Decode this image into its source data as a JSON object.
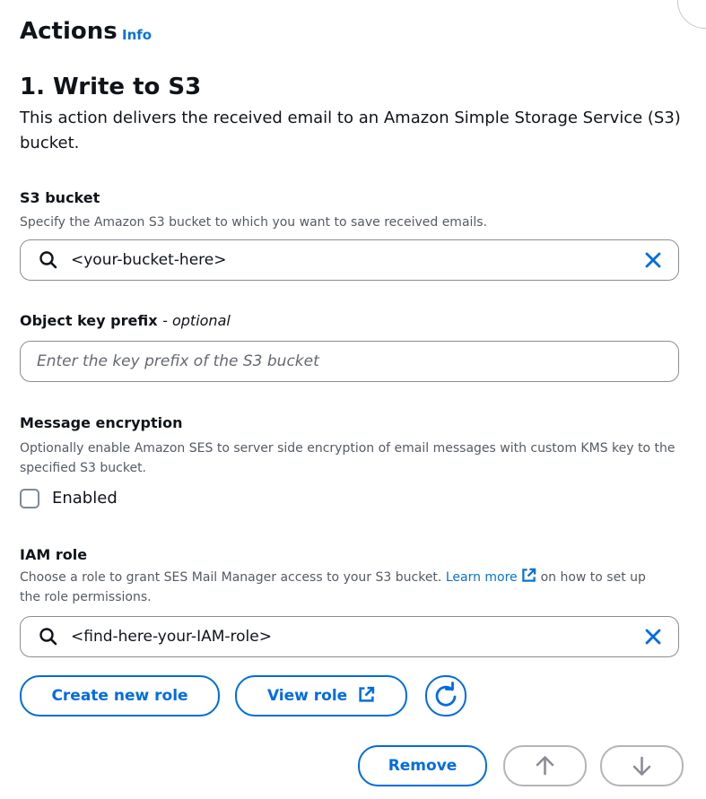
{
  "header": {
    "title": "Actions",
    "info_link": "Info"
  },
  "step": {
    "title": "1. Write to S3",
    "description": "This action delivers the received email to an Amazon Simple Storage Service (S3) bucket."
  },
  "s3_bucket": {
    "label": "S3 bucket",
    "description": "Specify the Amazon S3 bucket to which you want to save received emails.",
    "value": "<your-bucket-here>"
  },
  "object_key_prefix": {
    "label": "Object key prefix",
    "optional": "- optional",
    "placeholder": "Enter the key prefix of the S3 bucket"
  },
  "message_encryption": {
    "label": "Message encryption",
    "description": "Optionally enable Amazon SES to server side encryption of email messages with custom KMS key to the specified S3 bucket.",
    "checkbox_label": "Enabled",
    "checked": false
  },
  "iam_role": {
    "label": "IAM role",
    "description_before": "Choose a role to grant SES Mail Manager access to your S3 bucket.",
    "learn_more": "Learn more",
    "description_after": "on how to set up the role permissions.",
    "value": "<find-here-your-IAM-role>",
    "create_button": "Create new role",
    "view_button": "View role"
  },
  "footer": {
    "remove_button": "Remove"
  },
  "colors": {
    "accent": "#006ce0",
    "link": "#0972d3",
    "muted_border": "#b4b4bb"
  },
  "icons": [
    "search-icon",
    "close-icon",
    "external-link-icon",
    "refresh-icon",
    "arrow-up-icon",
    "arrow-down-icon"
  ]
}
